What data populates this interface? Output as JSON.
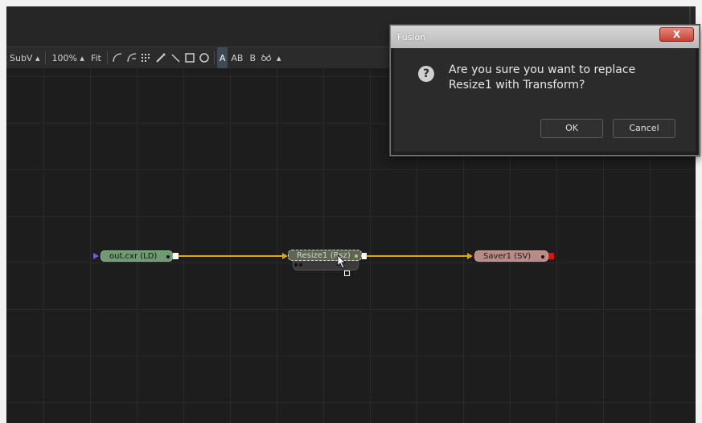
{
  "toolbar": {
    "view_label": "SubV ▴",
    "zoom_label": "100% ▴",
    "fit_label": "Fit",
    "text_tool_a": "A",
    "text_tool_ab": "AB",
    "text_tool_b": "B",
    "more_label": "▴",
    "icons": [
      "connection-curve-icon",
      "connection-routed-icon",
      "grid-icon",
      "brush-icon",
      "wand-icon",
      "square-icon",
      "circle-icon",
      "glasses-icon"
    ]
  },
  "nodes": [
    {
      "label": "out.cxr (LD)",
      "color": "#6f9a72"
    },
    {
      "label": "Resize1 (Rsz)",
      "color": "#5e6650"
    },
    {
      "label": "Saver1 (SV)",
      "color": "#b98b86"
    }
  ],
  "dialog": {
    "title": "Fusion",
    "close_label": "X",
    "message": "Are you sure you want to replace\nResize1 with Transform?",
    "ok_label": "OK",
    "cancel_label": "Cancel",
    "question_icon": "question-icon",
    "question_glyph": "?"
  },
  "colors": {
    "link": "#e0a90a",
    "canvas": "#1d1d1d"
  }
}
